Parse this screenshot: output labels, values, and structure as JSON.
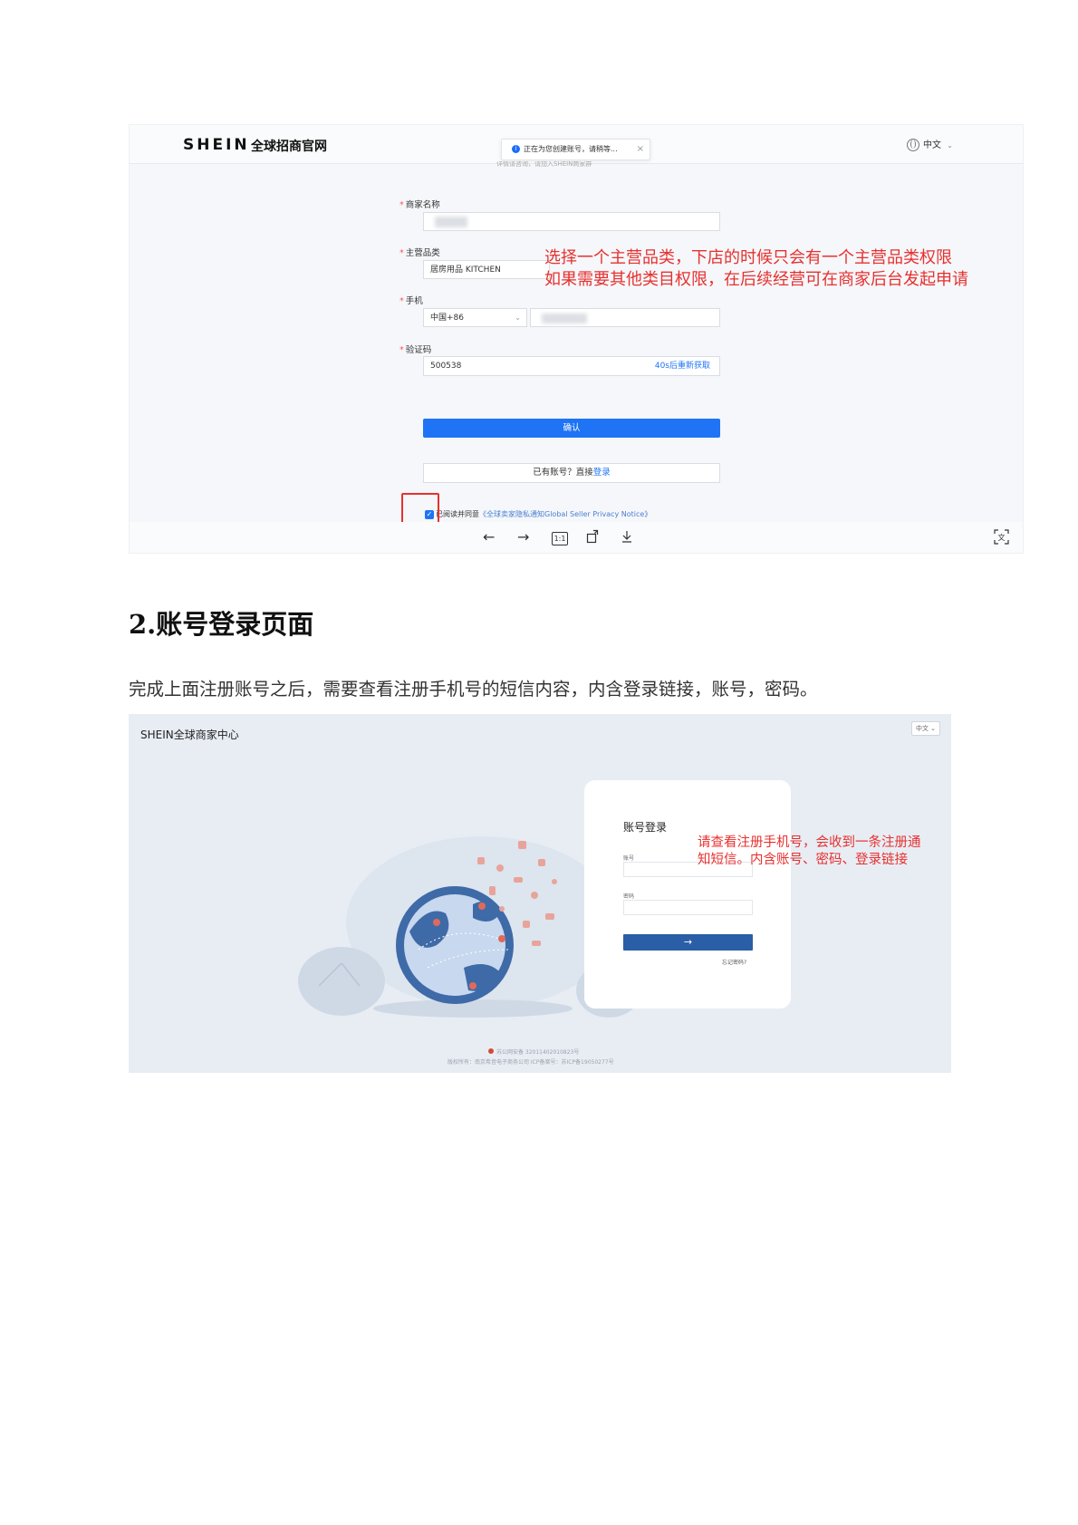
{
  "shot1": {
    "logo": "SHEIN",
    "logo_sub": "全球招商官网",
    "toast": "正在为您创建账号，请稍等...",
    "toast_close": "×",
    "blurred_line": "详情请咨询，请加入SHEIN商家群",
    "lang": "中文",
    "fields": {
      "merchant_label": "商家名称",
      "category_label": "主营品类",
      "category_value": "居房用品 KITCHEN",
      "phone_label": "手机",
      "phone_code": "中国+86",
      "code_label": "验证码",
      "code_value": "500538",
      "code_resend": "40s后重新获取"
    },
    "required_mark": "*",
    "confirm_button": "确认",
    "has_account_text": "已有账号？直接",
    "login_link": "登录",
    "agree_text": "已阅读并同意",
    "agree_link": "《全球卖家隐私通知Global Seller Privacy Notice》",
    "annotation_line1": "选择一个主营品类，下店的时候只会有一个主营品类权限",
    "annotation_line2": "如果需要其他类目权限，在后续经营可在商家后台发起申请"
  },
  "section": {
    "title": "2.账号登录页面",
    "paragraph": "完成上面注册账号之后，需要查看注册手机号的短信内容，内含登录链接，账号，密码。"
  },
  "shot2": {
    "brand": "SHEIN全球商家中心",
    "lang": "中文",
    "card_title": "账号登录",
    "account_label": "账号",
    "password_label": "密码",
    "submit_icon": "→",
    "forgot": "忘记密码?",
    "annotation_line1": "请查看注册手机号，会收到一条注册通",
    "annotation_line2": "知短信。内含账号、密码、登录链接",
    "footer_line1": "苏公网安备 32011402010823号",
    "footer_line2": "版权所有：南京希音电子商务公司 ICP备案号：苏ICP备19050277号"
  },
  "icons": {
    "info": "info-icon",
    "globe": "globe-icon",
    "check": "check-icon",
    "back": "arrow-left-icon",
    "forward": "arrow-right-icon",
    "actual_size": "actual-size-icon",
    "rotate": "rotate-icon",
    "download": "download-icon",
    "translate": "translate-icon"
  },
  "colors": {
    "accent_blue": "#1e74f5",
    "annotation_red": "#e8302e",
    "login_button": "#2a5ea6"
  }
}
